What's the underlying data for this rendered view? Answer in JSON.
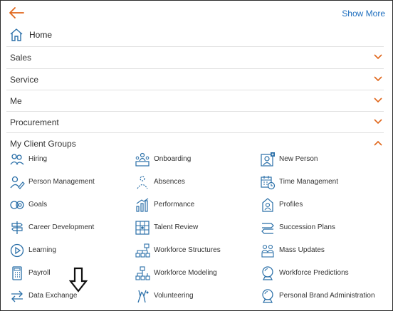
{
  "topbar": {
    "show_more": "Show More"
  },
  "home": {
    "label": "Home"
  },
  "sections": [
    {
      "label": "Sales",
      "expanded": false
    },
    {
      "label": "Service",
      "expanded": false
    },
    {
      "label": "Me",
      "expanded": false
    },
    {
      "label": "Procurement",
      "expanded": false
    },
    {
      "label": "My Client Groups",
      "expanded": true
    }
  ],
  "client_groups": {
    "col1": [
      "Hiring",
      "Person Management",
      "Goals",
      "Career Development",
      "Learning",
      "Payroll",
      "Data Exchange"
    ],
    "col2": [
      "Onboarding",
      "Absences",
      "Performance",
      "Talent Review",
      "Workforce Structures",
      "Workforce Modeling",
      "Volunteering"
    ],
    "col3": [
      "New Person",
      "Time Management",
      "Profiles",
      "Succession Plans",
      "Mass Updates",
      "Workforce Predictions",
      "Personal Brand Administration"
    ]
  },
  "colors": {
    "accent": "#e0661a",
    "link": "#1f6fbf",
    "icon": "#2a6fa8",
    "divider": "#e1e1e1"
  }
}
